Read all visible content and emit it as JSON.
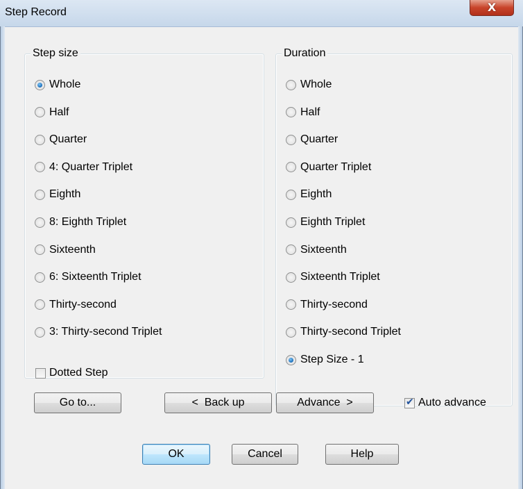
{
  "window": {
    "title": "Step Record",
    "close_glyph": "X"
  },
  "step_size": {
    "label": "Step size",
    "options": [
      {
        "label": "Whole",
        "checked": true
      },
      {
        "label": "Half",
        "checked": false
      },
      {
        "label": "Quarter",
        "checked": false
      },
      {
        "label": "4: Quarter Triplet",
        "checked": false
      },
      {
        "label": "Eighth",
        "checked": false
      },
      {
        "label": "8: Eighth Triplet",
        "checked": false
      },
      {
        "label": "Sixteenth",
        "checked": false
      },
      {
        "label": "6: Sixteenth Triplet",
        "checked": false
      },
      {
        "label": "Thirty-second",
        "checked": false
      },
      {
        "label": "3: Thirty-second Triplet",
        "checked": false
      }
    ]
  },
  "duration": {
    "label": "Duration",
    "options": [
      {
        "label": "Whole",
        "checked": false
      },
      {
        "label": "Half",
        "checked": false
      },
      {
        "label": "Quarter",
        "checked": false
      },
      {
        "label": "Quarter Triplet",
        "checked": false
      },
      {
        "label": "Eighth",
        "checked": false
      },
      {
        "label": "Eighth Triplet",
        "checked": false
      },
      {
        "label": "Sixteenth",
        "checked": false
      },
      {
        "label": "Sixteenth Triplet",
        "checked": false
      },
      {
        "label": "Thirty-second",
        "checked": false
      },
      {
        "label": "Thirty-second Triplet",
        "checked": false
      },
      {
        "label": "Step Size - 1",
        "checked": true
      }
    ]
  },
  "dotted_step": {
    "label": "Dotted Step",
    "checked": false
  },
  "auto_advance": {
    "label": "Auto advance",
    "checked": true
  },
  "buttons": {
    "goto": "Go to...",
    "back_up": "<  Back up",
    "advance": "Advance  >",
    "ok": "OK",
    "cancel": "Cancel",
    "help": "Help"
  }
}
